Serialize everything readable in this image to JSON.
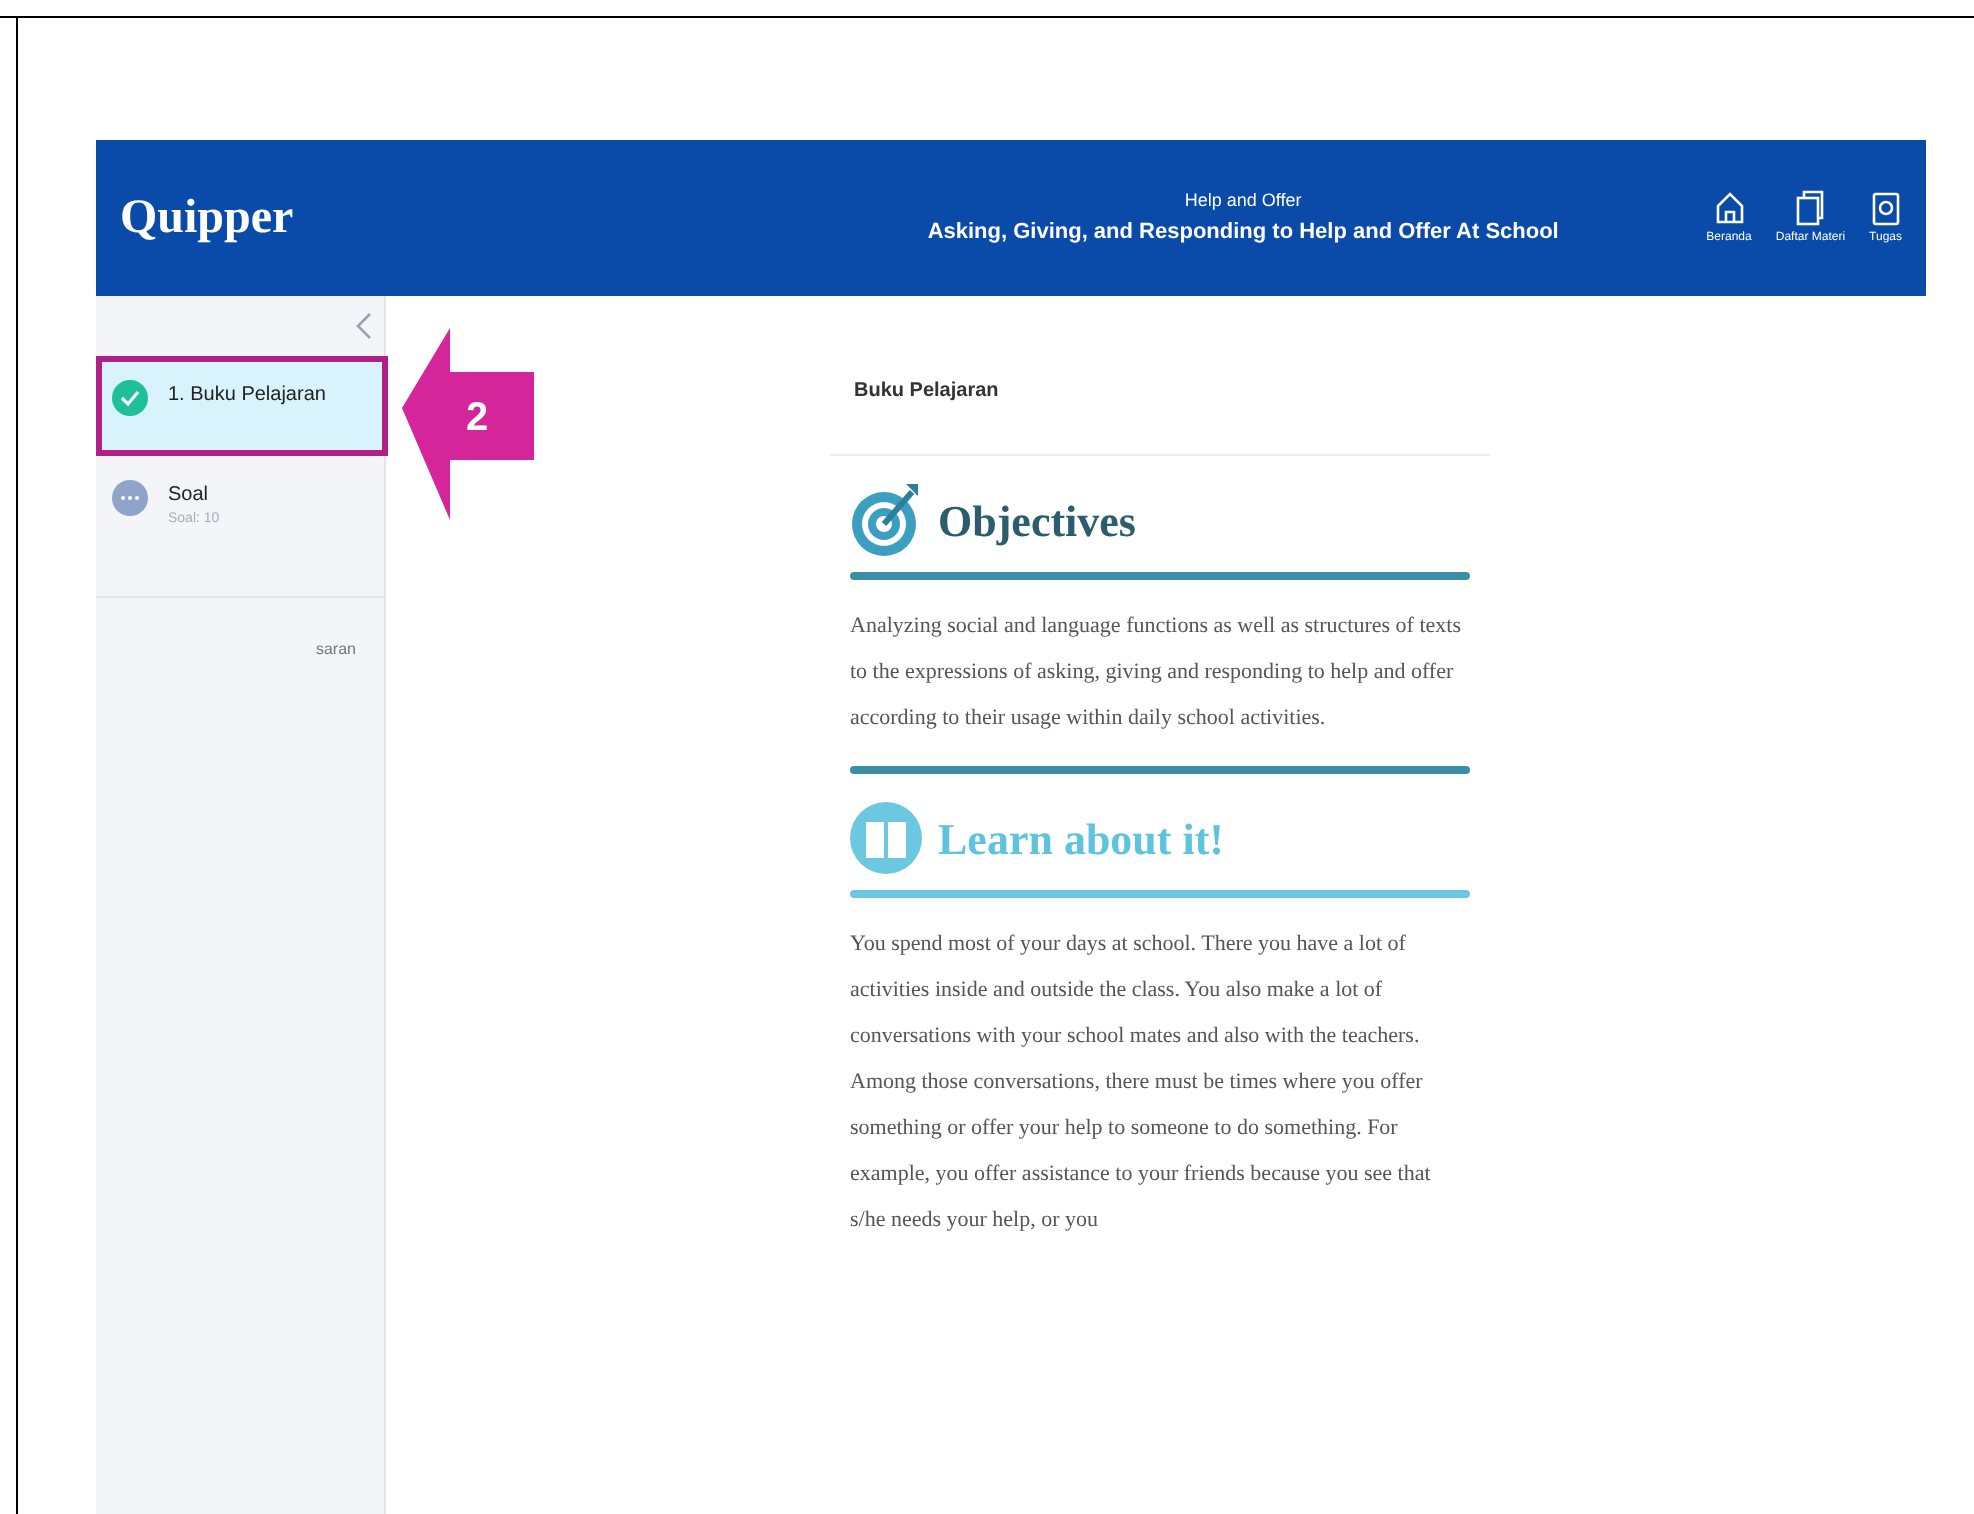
{
  "header": {
    "logo": "Quipper",
    "subtitle": "Help and Offer",
    "title": "Asking, Giving, and Responding to Help and Offer At School",
    "nav": [
      {
        "label": "Beranda",
        "kind": "home"
      },
      {
        "label": "Daftar Materi",
        "kind": "materials"
      },
      {
        "label": "Tugas",
        "kind": "tasks"
      }
    ]
  },
  "sidebar": {
    "items": [
      {
        "title": "1. Buku Pelajaran",
        "kind": "done",
        "selected": true
      },
      {
        "title": "Soal",
        "subtitle": "Soal: 10",
        "kind": "pending",
        "selected": false
      }
    ],
    "link": "saran"
  },
  "callout": {
    "label": "2"
  },
  "content": {
    "heading": "Buku Pelajaran",
    "sections": [
      {
        "kind": "objectives",
        "title": "Objectives",
        "text": "Analyzing social and language functions as well as structures of texts to the expressions of asking, giving and responding to help and offer according to their usage within daily school activities."
      },
      {
        "kind": "learn",
        "title": "Learn about it!",
        "text": "You spend most of your days at school. There you have a lot of activities inside and outside the class. You also make a lot of conversations with your school mates and also with the teachers. Among those conversations, there must be times where you offer something or offer your help to someone to do something. For example, you offer assistance to your friends because you see that s/he needs your help, or you"
      }
    ]
  }
}
